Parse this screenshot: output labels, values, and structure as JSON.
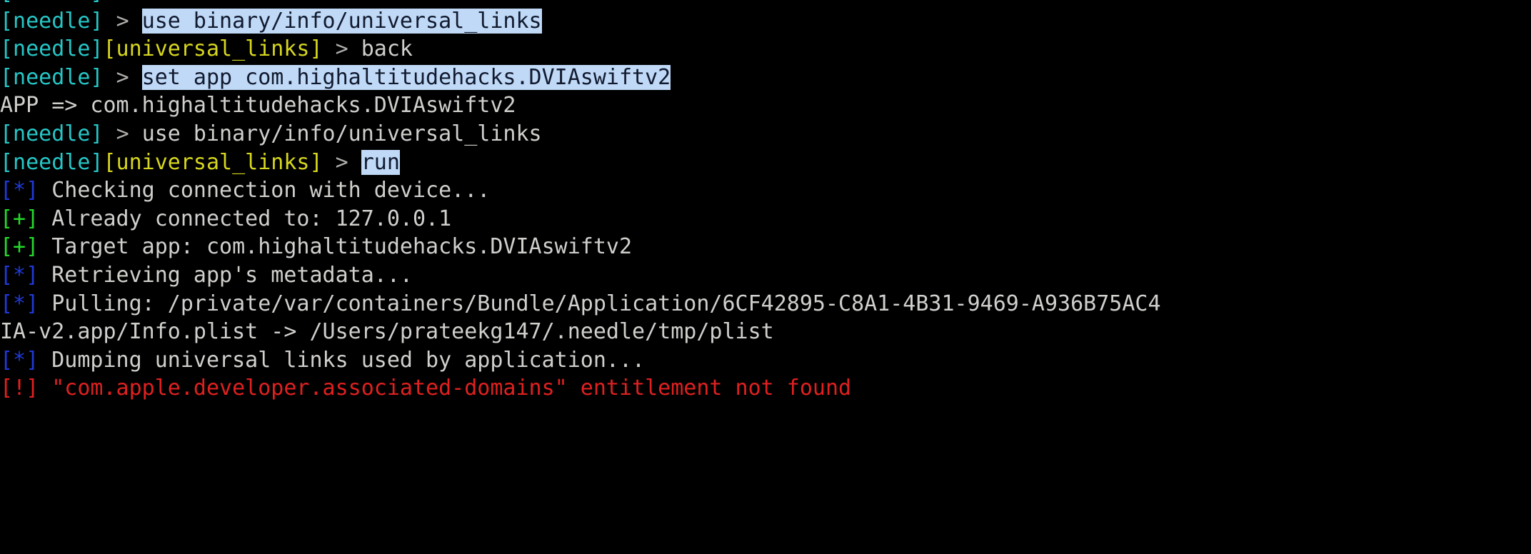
{
  "terminal": {
    "app_name": "needle",
    "background_color": "#000000",
    "foreground_color": "#d0cfcc",
    "selection_background": "#bfd9f7",
    "selection_foreground": "#121a2e",
    "colors": {
      "cyan": "#26c6c6",
      "yellow": "#d6d620",
      "blue": "#1f39d6",
      "green": "#24d82b",
      "red": "#e02020",
      "prompt_gray": "#b0aeab"
    },
    "prompt_tokens": {
      "module_root": "[needle]",
      "module_universal_links": "[universal_links]",
      "caret": ">",
      "status_info": "[*]",
      "status_ok": "[+]",
      "status_warn": "[!]"
    },
    "lines": [
      {
        "id": "line-0-clipped",
        "kind": "prompt",
        "clipped": true,
        "segments": [
          {
            "text": "[needle]",
            "color": "cyan"
          },
          {
            "text": " ",
            "color": "default"
          },
          {
            "text": ">",
            "color": "prompt"
          }
        ]
      },
      {
        "id": "line-1",
        "kind": "prompt-command",
        "segments": [
          {
            "text": "[needle]",
            "color": "cyan"
          },
          {
            "text": " ",
            "color": "default"
          },
          {
            "text": ">",
            "color": "prompt"
          },
          {
            "text": " ",
            "color": "default"
          },
          {
            "text": "use binary/info/universal_links",
            "color": "default",
            "selected": true
          }
        ]
      },
      {
        "id": "line-2",
        "kind": "prompt-command",
        "segments": [
          {
            "text": "[needle]",
            "color": "cyan"
          },
          {
            "text": "[universal_links]",
            "color": "yellow"
          },
          {
            "text": " ",
            "color": "default"
          },
          {
            "text": ">",
            "color": "prompt"
          },
          {
            "text": " ",
            "color": "default"
          },
          {
            "text": "back",
            "color": "default"
          }
        ]
      },
      {
        "id": "line-3",
        "kind": "prompt-command",
        "segments": [
          {
            "text": "[needle]",
            "color": "cyan"
          },
          {
            "text": " ",
            "color": "default"
          },
          {
            "text": ">",
            "color": "prompt"
          },
          {
            "text": " ",
            "color": "default"
          },
          {
            "text": "set app com.highaltitudehacks.DVIAswiftv2",
            "color": "default",
            "selected": true
          }
        ]
      },
      {
        "id": "line-4",
        "kind": "output",
        "segments": [
          {
            "text": "APP => com.highaltitudehacks.DVIAswiftv2",
            "color": "default"
          }
        ]
      },
      {
        "id": "line-5",
        "kind": "prompt-command",
        "segments": [
          {
            "text": "[needle]",
            "color": "cyan"
          },
          {
            "text": " ",
            "color": "default"
          },
          {
            "text": ">",
            "color": "prompt"
          },
          {
            "text": " ",
            "color": "default"
          },
          {
            "text": "use binary/info/universal_links",
            "color": "default"
          }
        ]
      },
      {
        "id": "line-6",
        "kind": "prompt-command",
        "segments": [
          {
            "text": "[needle]",
            "color": "cyan"
          },
          {
            "text": "[universal_links]",
            "color": "yellow"
          },
          {
            "text": " ",
            "color": "default"
          },
          {
            "text": ">",
            "color": "prompt"
          },
          {
            "text": " ",
            "color": "default"
          },
          {
            "text": "run",
            "color": "default",
            "selected": true
          }
        ]
      },
      {
        "id": "line-7",
        "kind": "status-info",
        "segments": [
          {
            "text": "[*]",
            "color": "blue"
          },
          {
            "text": " Checking connection with device...",
            "color": "default"
          }
        ]
      },
      {
        "id": "line-8",
        "kind": "status-ok",
        "segments": [
          {
            "text": "[+]",
            "color": "green"
          },
          {
            "text": " Already connected to: 127.0.0.1",
            "color": "default"
          }
        ]
      },
      {
        "id": "line-9",
        "kind": "status-ok",
        "segments": [
          {
            "text": "[+]",
            "color": "green"
          },
          {
            "text": " Target app: com.highaltitudehacks.DVIAswiftv2",
            "color": "default"
          }
        ]
      },
      {
        "id": "line-10",
        "kind": "status-info",
        "segments": [
          {
            "text": "[*]",
            "color": "blue"
          },
          {
            "text": " Retrieving app's metadata...",
            "color": "default"
          }
        ]
      },
      {
        "id": "line-11",
        "kind": "status-info",
        "segments": [
          {
            "text": "[*]",
            "color": "blue"
          },
          {
            "text": " Pulling: /private/var/containers/Bundle/Application/6CF42895-C8A1-4B31-9469-A936B75AC4",
            "color": "default"
          }
        ]
      },
      {
        "id": "line-12",
        "kind": "output-wrapped",
        "segments": [
          {
            "text": "IA-v2.app/Info.plist -> /Users/prateekg147/.needle/tmp/plist",
            "color": "default"
          }
        ]
      },
      {
        "id": "line-13",
        "kind": "status-info",
        "segments": [
          {
            "text": "[*]",
            "color": "blue"
          },
          {
            "text": " Dumping universal links used by application...",
            "color": "default"
          }
        ]
      },
      {
        "id": "line-14",
        "kind": "status-warn",
        "segments": [
          {
            "text": "[!]",
            "color": "red"
          },
          {
            "text": " \"com.apple.developer.associated-domains\" entitlement not found",
            "color": "red"
          }
        ]
      }
    ]
  }
}
